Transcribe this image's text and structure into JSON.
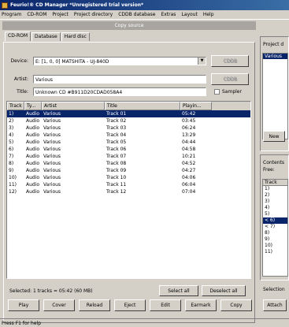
{
  "window": {
    "title": "Feurio!® CD Manager *Unregistered trial version*"
  },
  "menu": [
    "Program",
    "CD-ROM",
    "Project",
    "Project directory",
    "CDDB database",
    "Extras",
    "Layout",
    "Help"
  ],
  "copy_source": {
    "header": "Copy source"
  },
  "tabs": [
    "CD-ROM",
    "Database",
    "Hard disc"
  ],
  "device": {
    "label": "Device:",
    "value": "E: [1, 0, 0] MATSHITA - UJ-840D"
  },
  "artist": {
    "label": "Artist:",
    "value": "Various"
  },
  "title_field": {
    "label": "Title:",
    "value": "Unknown CD #B911D20CDAD058A4"
  },
  "sampler": {
    "label": "Sampler"
  },
  "side_buttons": {
    "top": "CDDB",
    "bottom": "CDDB"
  },
  "columns": [
    "Track",
    "Ty...",
    "Artist",
    "Title",
    "Playin..."
  ],
  "tracks": [
    {
      "n": "1)",
      "type": "Audio",
      "artist": "Various",
      "title": "Track 01",
      "time": "05:42"
    },
    {
      "n": "2)",
      "type": "Audio",
      "artist": "Various",
      "title": "Track 02",
      "time": "03:45"
    },
    {
      "n": "3)",
      "type": "Audio",
      "artist": "Various",
      "title": "Track 03",
      "time": "06:24"
    },
    {
      "n": "4)",
      "type": "Audio",
      "artist": "Various",
      "title": "Track 04",
      "time": "13:29"
    },
    {
      "n": "5)",
      "type": "Audio",
      "artist": "Various",
      "title": "Track 05",
      "time": "04:44"
    },
    {
      "n": "6)",
      "type": "Audio",
      "artist": "Various",
      "title": "Track 06",
      "time": "04:58"
    },
    {
      "n": "7)",
      "type": "Audio",
      "artist": "Various",
      "title": "Track 07",
      "time": "10:21"
    },
    {
      "n": "8)",
      "type": "Audio",
      "artist": "Various",
      "title": "Track 08",
      "time": "04:52"
    },
    {
      "n": "9)",
      "type": "Audio",
      "artist": "Various",
      "title": "Track 09",
      "time": "04:27"
    },
    {
      "n": "10)",
      "type": "Audio",
      "artist": "Various",
      "title": "Track 10",
      "time": "04:06"
    },
    {
      "n": "11)",
      "type": "Audio",
      "artist": "Various",
      "title": "Track 11",
      "time": "06:04"
    },
    {
      "n": "12)",
      "type": "Audio",
      "artist": "Various",
      "title": "Track 12",
      "time": "07:04"
    }
  ],
  "selection_status": "Selected: 1 tracks = 05:42 (60 MB)",
  "select_all": "Select all",
  "deselect_all": "Deselect all",
  "bottom_buttons": [
    "Play",
    "Cover",
    "Reload",
    "Eject",
    "Edit",
    "Earmark",
    "Copy"
  ],
  "right_panel": {
    "project_label": "Project d",
    "project_item": "Various",
    "new_button": "New",
    "contents_label": "Contents",
    "free_label": "Free:",
    "track_col": "Track",
    "items": [
      "1)",
      "2)",
      "3)",
      "4)",
      "5)",
      "< 6)",
      "< 7)",
      "8)",
      "9)",
      "10)",
      "11)"
    ],
    "selection_label": "Selection",
    "attach_button": "Attach"
  },
  "status_bar": "Press F1 for help",
  "colors": {
    "title_start": "#0a246a",
    "title_end": "#3a6ea5",
    "selection": "#0a246a",
    "face": "#d4d0c8"
  }
}
